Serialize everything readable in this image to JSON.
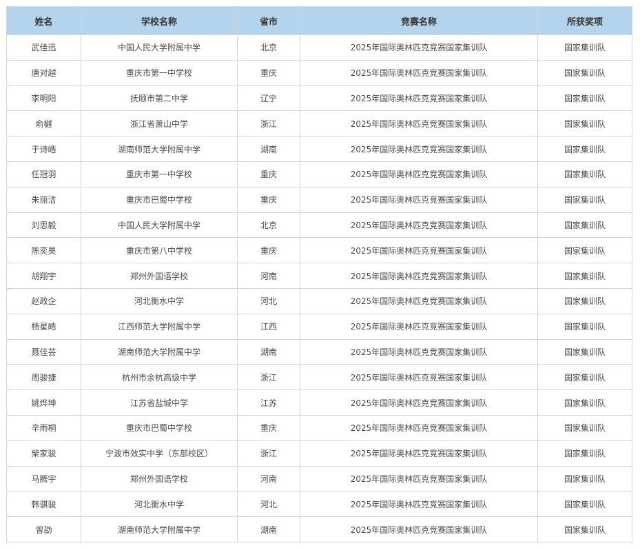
{
  "table": {
    "headers": [
      "姓名",
      "学校名称",
      "省市",
      "竞赛名称",
      "所获奖项"
    ],
    "rows": [
      [
        "武佳迅",
        "中国人民大学附属中学",
        "北京",
        "2025年国际奥林匹克竞赛国家集训队",
        "国家集训队"
      ],
      [
        "唐对越",
        "重庆市第一中学校",
        "重庆",
        "2025年国际奥林匹克竞赛国家集训队",
        "国家集训队"
      ],
      [
        "李明阳",
        "抚顺市第二中学",
        "辽宁",
        "2025年国际奥林匹克竞赛国家集训队",
        "国家集训队"
      ],
      [
        "俞樾",
        "浙江省萧山中学",
        "浙江",
        "2025年国际奥林匹克竞赛国家集训队",
        "国家集训队"
      ],
      [
        "于诗皓",
        "湖南师范大学附属中学",
        "湖南",
        "2025年国际奥林匹克竞赛国家集训队",
        "国家集训队"
      ],
      [
        "任冠羽",
        "重庆市第一中学校",
        "重庆",
        "2025年国际奥林匹克竞赛国家集训队",
        "国家集训队"
      ],
      [
        "朱丽洁",
        "重庆市巴蜀中学校",
        "重庆",
        "2025年国际奥林匹克竞赛国家集训队",
        "国家集训队"
      ],
      [
        "刘思毅",
        "中国人民大学附属中学",
        "北京",
        "2025年国际奥林匹克竞赛国家集训队",
        "国家集训队"
      ],
      [
        "陈奕昊",
        "重庆市第八中学校",
        "重庆",
        "2025年国际奥林匹克竞赛国家集训队",
        "国家集训队"
      ],
      [
        "胡翔宇",
        "郑州外国语学校",
        "河南",
        "2025年国际奥林匹克竞赛国家集训队",
        "国家集训队"
      ],
      [
        "赵政企",
        "河北衡水中学",
        "河北",
        "2025年国际奥林匹克竞赛国家集训队",
        "国家集训队"
      ],
      [
        "杨星皓",
        "江西师范大学附属中学",
        "江西",
        "2025年国际奥林匹克竞赛国家集训队",
        "国家集训队"
      ],
      [
        "聂佳芸",
        "湖南师范大学附属中学",
        "湖南",
        "2025年国际奥林匹克竞赛国家集训队",
        "国家集训队"
      ],
      [
        "周骏捷",
        "杭州市余杭高级中学",
        "浙江",
        "2025年国际奥林匹克竞赛国家集训队",
        "国家集训队"
      ],
      [
        "姚烨坤",
        "江苏省盐城中学",
        "江苏",
        "2025年国际奥林匹克竞赛国家集训队",
        "国家集训队"
      ],
      [
        "辛雨桐",
        "重庆市巴蜀中学校",
        "重庆",
        "2025年国际奥林匹克竞赛国家集训队",
        "国家集训队"
      ],
      [
        "柴家骏",
        "宁波市效实中学（东部校区）",
        "浙江",
        "2025年国际奥林匹克竞赛国家集训队",
        "国家集训队"
      ],
      [
        "马腾宇",
        "郑州外国语学校",
        "河南",
        "2025年国际奥林匹克竞赛国家集训队",
        "国家集训队"
      ],
      [
        "韩骐骏",
        "河北衡水中学",
        "河北",
        "2025年国际奥林匹克竞赛国家集训队",
        "国家集训队"
      ],
      [
        "曾劭",
        "湖南师范大学附属中学",
        "湖南",
        "2025年国际奥林匹克竞赛国家集训队",
        "国家集训队"
      ]
    ]
  },
  "colors": {
    "header_bg": "#b4d4ee",
    "border": "#d4d4d4",
    "header_text": "#333333",
    "cell_text": "#4a4a4a"
  }
}
